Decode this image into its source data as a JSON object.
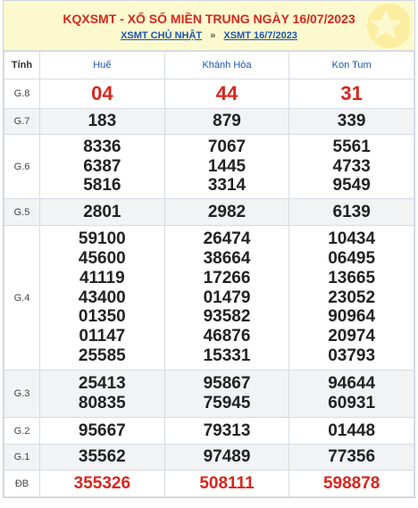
{
  "header": {
    "title": "KQXSMT - XỔ SỐ MIỀN TRUNG NGÀY 16/07/2023",
    "link1": "XSMT CHỦ NHẬT",
    "separator": "»",
    "link2": "XSMT 16/7/2023"
  },
  "table": {
    "columns": [
      "Tỉnh",
      "Huế",
      "Khánh Hòa",
      "Kon Tum"
    ],
    "rows": [
      {
        "label": "G.8",
        "values": [
          "04",
          "44",
          "31"
        ]
      },
      {
        "label": "G.7",
        "values": [
          "183",
          "879",
          "339"
        ]
      },
      {
        "label": "G.6",
        "values": [
          [
            "8336",
            "6387",
            "5816"
          ],
          [
            "7067",
            "1445",
            "3314"
          ],
          [
            "5561",
            "4733",
            "9549"
          ]
        ]
      },
      {
        "label": "G.5",
        "values": [
          "2801",
          "2982",
          "6139"
        ]
      },
      {
        "label": "G.4",
        "values": [
          [
            "59100",
            "45600",
            "41119",
            "43400",
            "01350",
            "01147",
            "25585"
          ],
          [
            "26474",
            "38664",
            "17266",
            "01479",
            "93582",
            "46876",
            "15331"
          ],
          [
            "10434",
            "06495",
            "13665",
            "23052",
            "90964",
            "20974",
            "03793"
          ]
        ]
      },
      {
        "label": "G.3",
        "values": [
          [
            "25413",
            "80835"
          ],
          [
            "95867",
            "75945"
          ],
          [
            "94644",
            "60931"
          ]
        ]
      },
      {
        "label": "G.2",
        "values": [
          "95667",
          "79313",
          "01448"
        ]
      },
      {
        "label": "G.1",
        "values": [
          "35562",
          "97489",
          "77356"
        ]
      },
      {
        "label": "ĐB",
        "values": [
          "355326",
          "508111",
          "598878"
        ]
      }
    ]
  },
  "colors": {
    "accent_red": "#d9261c",
    "link_blue": "#1a56b0",
    "header_bg": "#fdf9cf"
  }
}
